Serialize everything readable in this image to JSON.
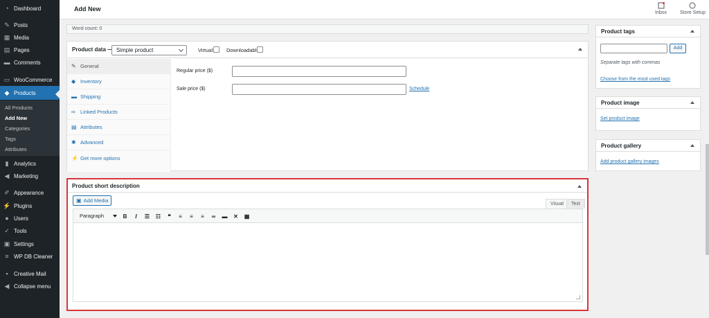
{
  "sidebar": {
    "items": [
      {
        "label": "Dashboard",
        "icon": "dashboard-icon"
      },
      {
        "label": "Posts",
        "icon": "pin-icon"
      },
      {
        "label": "Media",
        "icon": "media-icon"
      },
      {
        "label": "Pages",
        "icon": "pages-icon"
      },
      {
        "label": "Comments",
        "icon": "comments-icon"
      },
      {
        "label": "WooCommerce",
        "icon": "woocommerce-icon"
      },
      {
        "label": "Products",
        "icon": "products-icon"
      },
      {
        "label": "Analytics",
        "icon": "analytics-icon"
      },
      {
        "label": "Marketing",
        "icon": "megaphone-icon"
      },
      {
        "label": "Appearance",
        "icon": "brush-icon"
      },
      {
        "label": "Plugins",
        "icon": "plugin-icon"
      },
      {
        "label": "Users",
        "icon": "users-icon"
      },
      {
        "label": "Tools",
        "icon": "wrench-icon"
      },
      {
        "label": "Settings",
        "icon": "settings-icon"
      },
      {
        "label": "WP DB Cleaner",
        "icon": "database-icon"
      },
      {
        "label": "Creative Mail",
        "icon": "creative-mail-icon"
      },
      {
        "label": "Collapse menu",
        "icon": "collapse-icon"
      }
    ],
    "submenu": [
      "All Products",
      "Add New",
      "Categories",
      "Tags",
      "Attributes"
    ]
  },
  "header": {
    "title": "Add New",
    "inbox_label": "Inbox",
    "store_setup_label": "Store Setup"
  },
  "word_count": "Word count: 0",
  "product_data": {
    "title": "Product data —",
    "type_selected": "Simple product",
    "virtual_label": "Virtual:",
    "downloadable_label": "Downloadable:",
    "tabs": [
      {
        "label": "General",
        "icon": "wrench-icon"
      },
      {
        "label": "Inventory",
        "icon": "tag-icon"
      },
      {
        "label": "Shipping",
        "icon": "truck-icon"
      },
      {
        "label": "Linked Products",
        "icon": "link-icon"
      },
      {
        "label": "Attributes",
        "icon": "table-icon"
      },
      {
        "label": "Advanced",
        "icon": "gear-icon"
      },
      {
        "label": "Get more options",
        "icon": "plugin-icon"
      }
    ],
    "regular_price_label": "Regular price ($)",
    "sale_price_label": "Sale price ($)",
    "schedule_link": "Schedule"
  },
  "short_description": {
    "title": "Product short description",
    "add_media": "Add Media",
    "tab_visual": "Visual",
    "tab_text": "Text",
    "format_select": "Paragraph",
    "toolbar": [
      "bold-icon",
      "italic-icon",
      "bullet-list-icon",
      "numbered-list-icon",
      "blockquote-icon",
      "align-left-icon",
      "align-center-icon",
      "align-right-icon",
      "link-icon",
      "read-more-icon",
      "fullscreen-icon",
      "toolbar-toggle-icon"
    ]
  },
  "right": {
    "tags_title": "Product tags",
    "tags_add": "Add",
    "tags_hint": "Separate tags with commas",
    "tags_choose": "Choose from the most used tags",
    "image_title": "Product image",
    "image_link": "Set product image",
    "gallery_title": "Product gallery",
    "gallery_link": "Add product gallery images"
  },
  "colors": {
    "sidebar_bg": "#1d2327",
    "active_blue": "#2271b1",
    "highlight_red": "#d63638"
  }
}
